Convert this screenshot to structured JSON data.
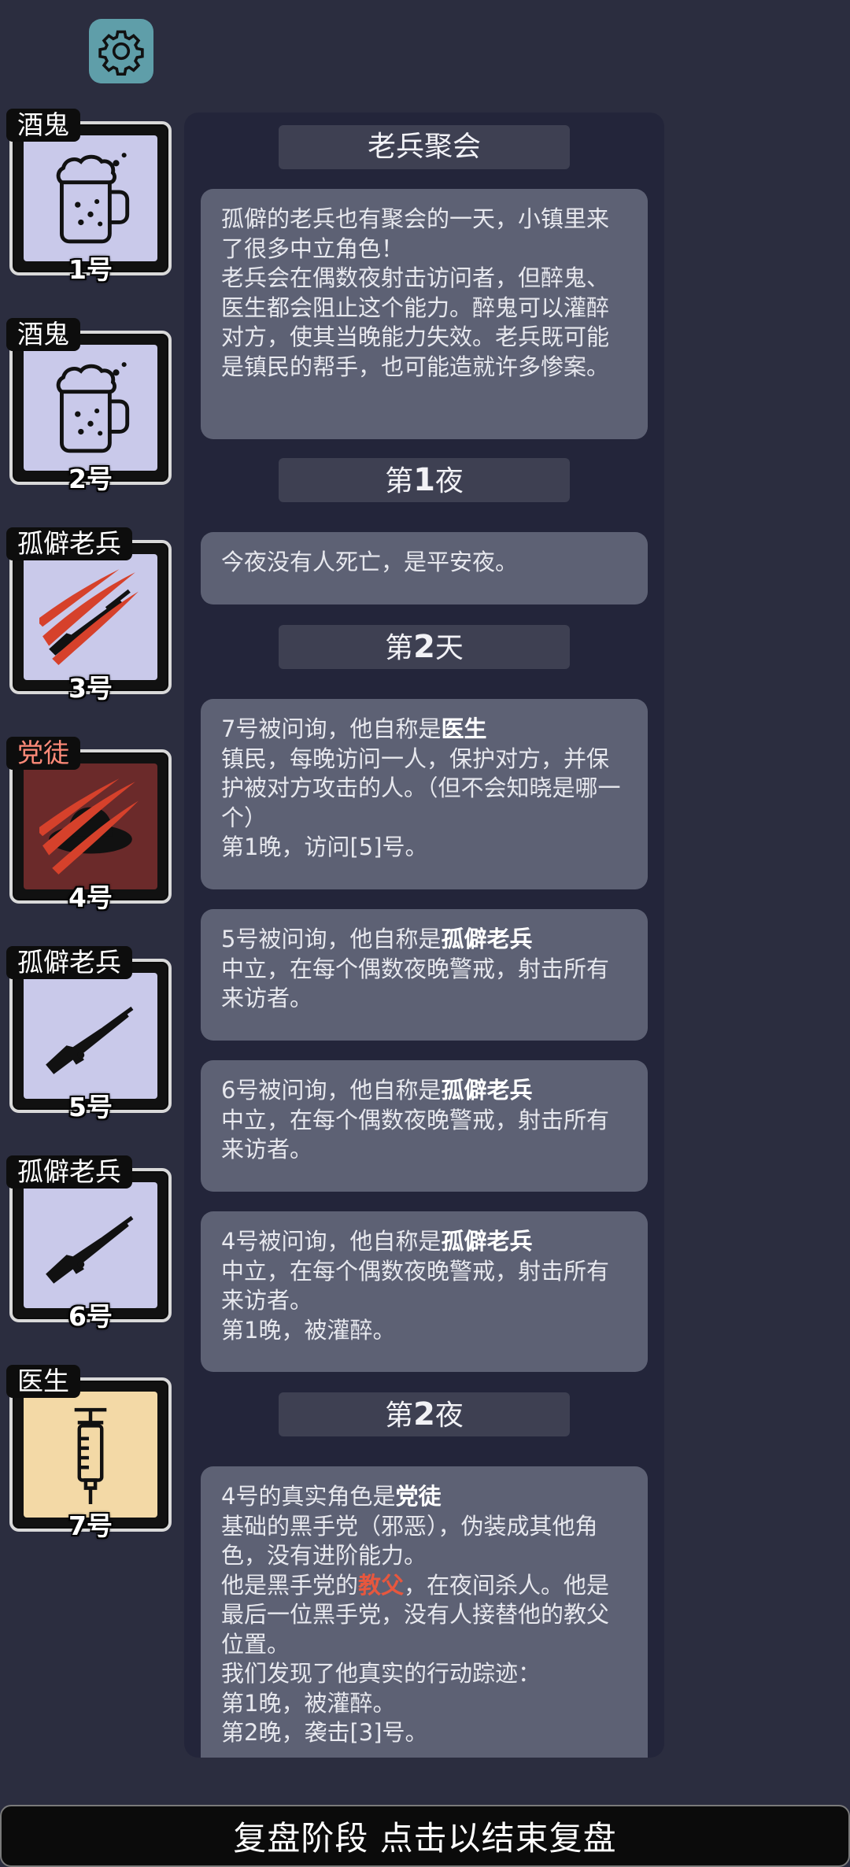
{
  "players": [
    {
      "role": "酒鬼",
      "number": "1号"
    },
    {
      "role": "酒鬼",
      "number": "2号"
    },
    {
      "role": "孤僻老兵",
      "number": "3号"
    },
    {
      "role": "党徒",
      "number": "4号"
    },
    {
      "role": "孤僻老兵",
      "number": "5号"
    },
    {
      "role": "孤僻老兵",
      "number": "6号"
    },
    {
      "role": "医生",
      "number": "7号"
    }
  ],
  "colors": {
    "card_normal": "#c9c9ea",
    "card_evil": "#6b2a2a",
    "card_doctor": "#f3d9a6",
    "evil_role_text": "#ff8a78",
    "highlight_red": "#e7573e",
    "gear_bg": "#5f9ea9"
  },
  "log": {
    "title": "老兵聚会",
    "intro": [
      "孤僻的老兵也有聚会的一天，小镇里来了很多中立角色！",
      "老兵会在偶数夜射击访问者，但醉鬼、医生都会阻止这个能力。醉鬼可以灌醉对方，使其当晚能力失效。老兵既可能是镇民的帮手，也可能造就许多惨案。"
    ],
    "night1": {
      "pre": "第",
      "num": "1",
      "post": "夜"
    },
    "night1_text": "今夜没有人死亡，是平安夜。",
    "day2": {
      "pre": "第",
      "num": "2",
      "post": "天"
    },
    "claims": [
      {
        "prefix": "7号被问询，他自称是",
        "role": "医生",
        "lines": [
          "镇民，每晚访问一人，保护对方，并保护被对方攻击的人。（但不会知晓是哪一个）",
          "第1晚，访问[5]号。"
        ]
      },
      {
        "prefix": "5号被问询，他自称是",
        "role": "孤僻老兵",
        "lines": [
          "中立，在每个偶数夜晚警戒，射击所有来访者。"
        ]
      },
      {
        "prefix": "6号被问询，他自称是",
        "role": "孤僻老兵",
        "lines": [
          "中立，在每个偶数夜晚警戒，射击所有来访者。"
        ]
      },
      {
        "prefix": "4号被问询，他自称是",
        "role": "孤僻老兵",
        "lines": [
          "中立，在每个偶数夜晚警戒，射击所有来访者。",
          "第1晚，被灌醉。"
        ]
      }
    ],
    "night2": {
      "pre": "第",
      "num": "2",
      "post": "夜"
    },
    "reveal": {
      "prefix": "4号的真实角色是",
      "role": "党徒",
      "line1": "基础的黑手党（邪恶），伪装成其他角色，没有进阶能力。",
      "line2_pre": "他是黑手党的",
      "line2_red": "教父",
      "line2_post": "，在夜间杀人。他是最后一位黑手党，没有人接替他的教父位置。",
      "line3": "我们发现了他真实的行动踪迹：",
      "line4": "第1晚，被灌醉。",
      "line5": "第2晚，袭击[3]号。"
    }
  },
  "bottom_bar": {
    "label": "复盘阶段 点击以结束复盘"
  }
}
